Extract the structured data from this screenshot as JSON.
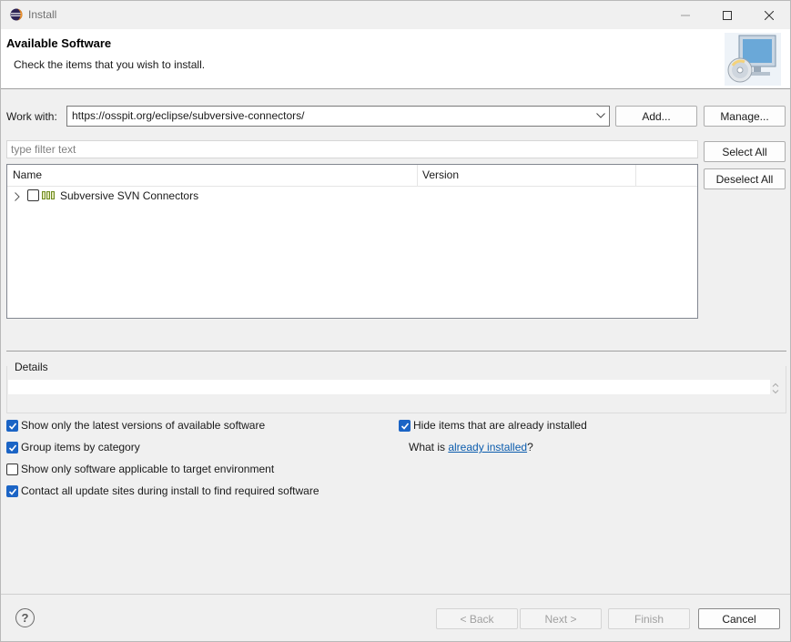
{
  "window": {
    "title": "Install"
  },
  "banner": {
    "title": "Available Software",
    "description": "Check the items that you wish to install."
  },
  "work_with": {
    "label": "Work with:",
    "value": "https://osspit.org/eclipse/subversive-connectors/",
    "add_label": "Add...",
    "manage_label": "Manage..."
  },
  "filter": {
    "placeholder": "type filter text"
  },
  "selection": {
    "select_all": "Select All",
    "deselect_all": "Deselect All"
  },
  "tree": {
    "columns": [
      "Name",
      "Version"
    ],
    "rows": [
      {
        "name": "Subversive SVN Connectors",
        "version": "",
        "checked": false
      }
    ]
  },
  "details": {
    "label": "Details"
  },
  "options": {
    "latest_versions": {
      "label": "Show only the latest versions of available software",
      "checked": true
    },
    "group_by_category": {
      "label": "Group items by category",
      "checked": true
    },
    "applicable_only": {
      "label": "Show only software applicable to target environment",
      "checked": false
    },
    "contact_sites": {
      "label": "Contact all update sites during install to find required software",
      "checked": true
    },
    "hide_installed": {
      "label": "Hide items that are already installed",
      "checked": true
    },
    "what_is_prefix": "What is ",
    "what_is_link": "already installed",
    "what_is_suffix": "?"
  },
  "footer": {
    "help_glyph": "?",
    "back": "< Back",
    "next": "Next >",
    "finish": "Finish",
    "cancel": "Cancel"
  },
  "colors": {
    "accent": "#1b64c5",
    "link": "#0b5cad"
  }
}
